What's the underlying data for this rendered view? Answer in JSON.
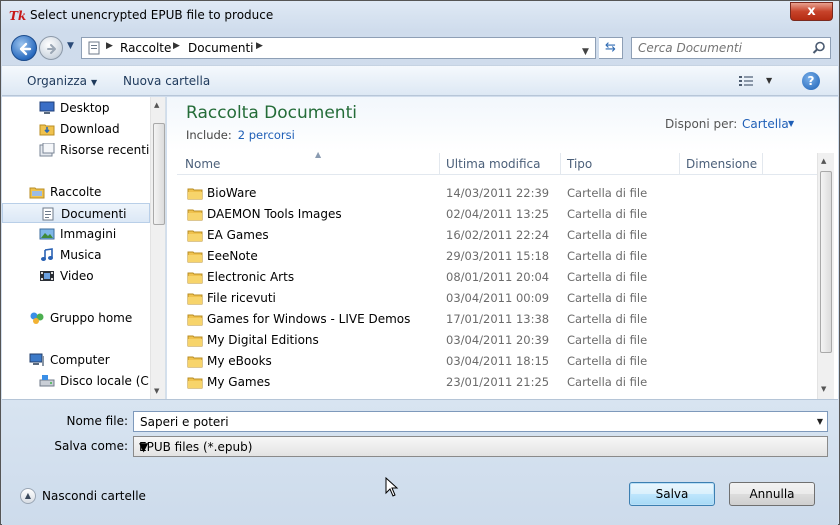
{
  "window": {
    "title": "Select unencrypted EPUB file to produce",
    "app_icon_text": "Tk",
    "close_label": "x"
  },
  "address": {
    "crumbs": [
      "Raccolte",
      "Documenti"
    ],
    "search_placeholder": "Cerca Documenti"
  },
  "toolbar": {
    "organize_label": "Organizza",
    "new_folder_label": "Nuova cartella",
    "help_label": "?"
  },
  "nav": {
    "items": [
      {
        "label": "Desktop",
        "icon": "desktop-icon"
      },
      {
        "label": "Download",
        "icon": "download-folder-icon"
      },
      {
        "label": "Risorse recenti",
        "icon": "recent-places-icon"
      },
      {
        "label": "Raccolte",
        "icon": "libraries-icon"
      },
      {
        "label": "Documenti",
        "icon": "documents-icon",
        "selected": true
      },
      {
        "label": "Immagini",
        "icon": "pictures-icon"
      },
      {
        "label": "Musica",
        "icon": "music-icon"
      },
      {
        "label": "Video",
        "icon": "video-icon"
      },
      {
        "label": "Gruppo home",
        "icon": "homegroup-icon"
      },
      {
        "label": "Computer",
        "icon": "computer-icon"
      },
      {
        "label": "Disco locale (C:)",
        "icon": "drive-icon"
      }
    ]
  },
  "library": {
    "title": "Raccolta Documenti",
    "include_label": "Include:",
    "include_link": "2 percorsi",
    "arrange_label": "Disponi per:",
    "arrange_value": "Cartella"
  },
  "columns": {
    "name": "Nome",
    "modified": "Ultima modifica",
    "type": "Tipo",
    "size": "Dimensione"
  },
  "files": [
    {
      "name": "BioWare",
      "date": "14/03/2011 22:39",
      "type": "Cartella di file"
    },
    {
      "name": "DAEMON Tools Images",
      "date": "02/04/2011 13:25",
      "type": "Cartella di file"
    },
    {
      "name": "EA Games",
      "date": "16/02/2011 22:24",
      "type": "Cartella di file"
    },
    {
      "name": "EeeNote",
      "date": "29/03/2011 15:18",
      "type": "Cartella di file"
    },
    {
      "name": "Electronic Arts",
      "date": "08/01/2011 20:04",
      "type": "Cartella di file"
    },
    {
      "name": "File ricevuti",
      "date": "03/04/2011 00:09",
      "type": "Cartella di file"
    },
    {
      "name": "Games for Windows - LIVE Demos",
      "date": "17/01/2011 13:38",
      "type": "Cartella di file"
    },
    {
      "name": "My Digital Editions",
      "date": "03/04/2011 20:39",
      "type": "Cartella di file"
    },
    {
      "name": "My eBooks",
      "date": "03/04/2011 18:15",
      "type": "Cartella di file"
    },
    {
      "name": "My Games",
      "date": "23/01/2011 21:25",
      "type": "Cartella di file"
    }
  ],
  "form": {
    "filename_label": "Nome file:",
    "filename_value": "Saperi e poteri",
    "saveas_label": "Salva come:",
    "saveas_value": "EPUB files (*.epub)",
    "hide_folders_label": "Nascondi cartelle",
    "save_label": "Salva",
    "cancel_label": "Annulla"
  },
  "colors": {
    "library_title": "#246c38",
    "link": "#1f5fb7",
    "folder": "#f0c24e"
  }
}
